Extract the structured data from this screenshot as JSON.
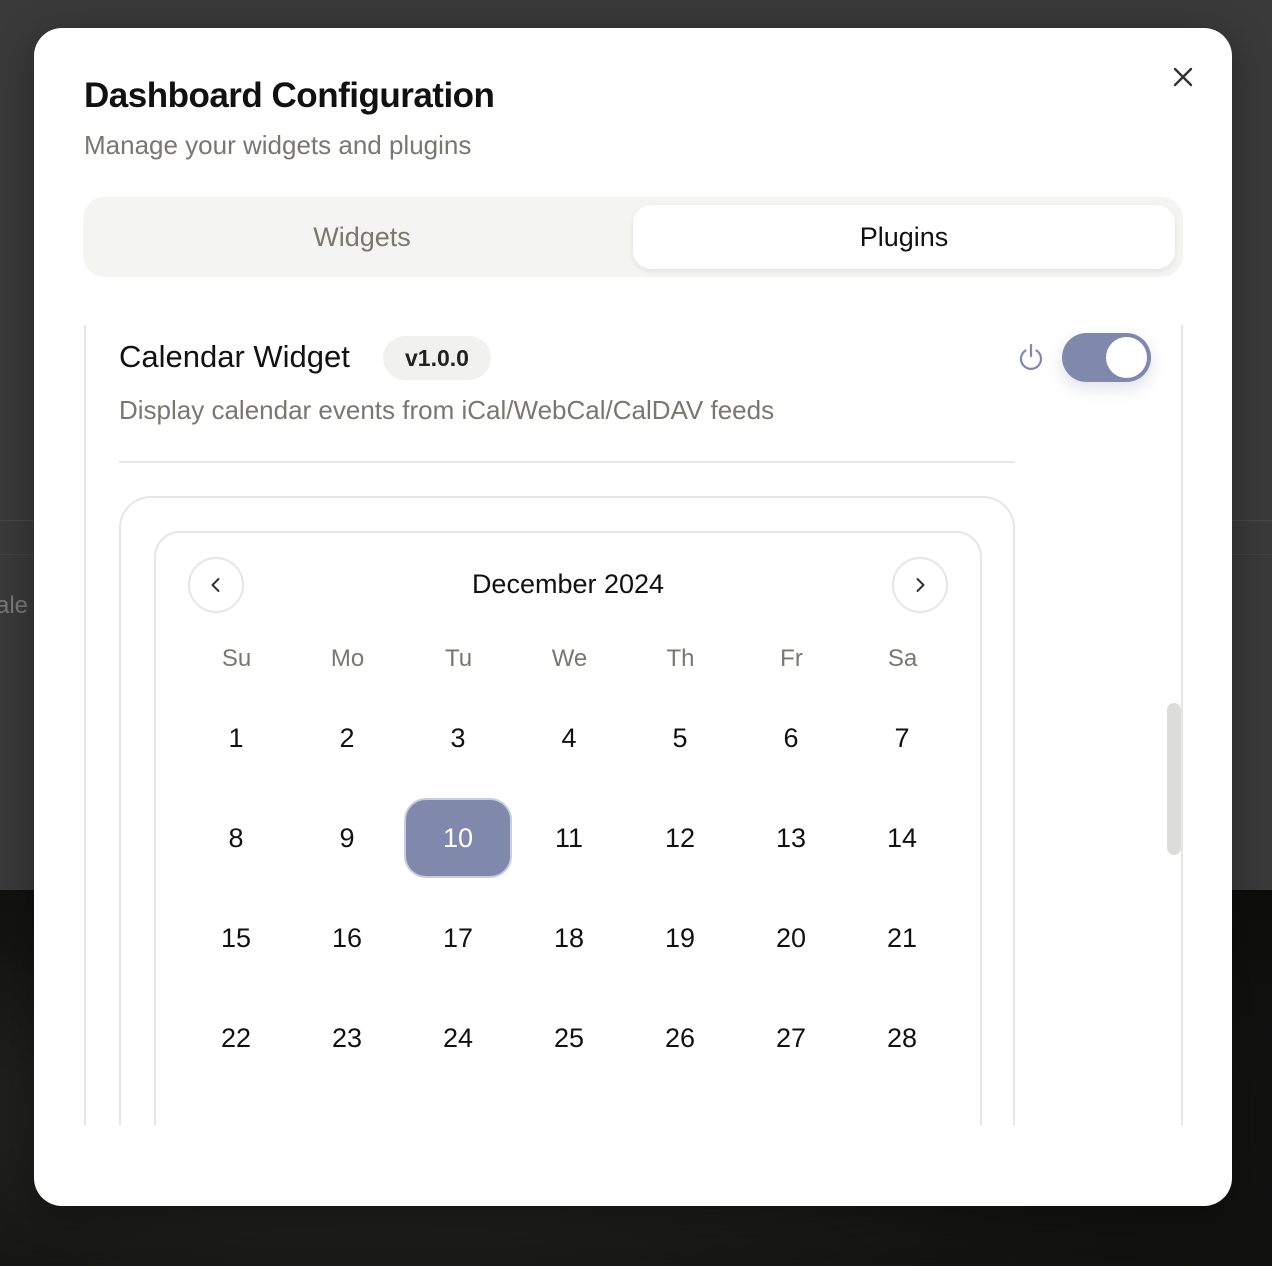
{
  "dialog": {
    "title": "Dashboard Configuration",
    "subtitle": "Manage your widgets and plugins"
  },
  "tabs": [
    {
      "label": "Widgets",
      "active": false
    },
    {
      "label": "Plugins",
      "active": true
    }
  ],
  "background_fragment": "ale",
  "plugin": {
    "name": "Calendar Widget",
    "version": "v1.0.0",
    "description": "Display calendar events from iCal/WebCal/CalDAV feeds",
    "enabled": true
  },
  "calendar": {
    "month_label": "December 2024",
    "weekdays": [
      "Su",
      "Mo",
      "Tu",
      "We",
      "Th",
      "Fr",
      "Sa"
    ],
    "weeks": [
      [
        "1",
        "2",
        "3",
        "4",
        "5",
        "6",
        "7"
      ],
      [
        "8",
        "9",
        "10",
        "11",
        "12",
        "13",
        "14"
      ],
      [
        "15",
        "16",
        "17",
        "18",
        "19",
        "20",
        "21"
      ],
      [
        "22",
        "23",
        "24",
        "25",
        "26",
        "27",
        "28"
      ]
    ],
    "selected_day": "10"
  },
  "colors": {
    "accent": "#8088ab",
    "muted_text": "#7a7670",
    "border": "#e6e6e4"
  },
  "icons": {
    "close": "close-icon",
    "power": "power-icon",
    "prev": "chevron-left-icon",
    "next": "chevron-right-icon"
  }
}
